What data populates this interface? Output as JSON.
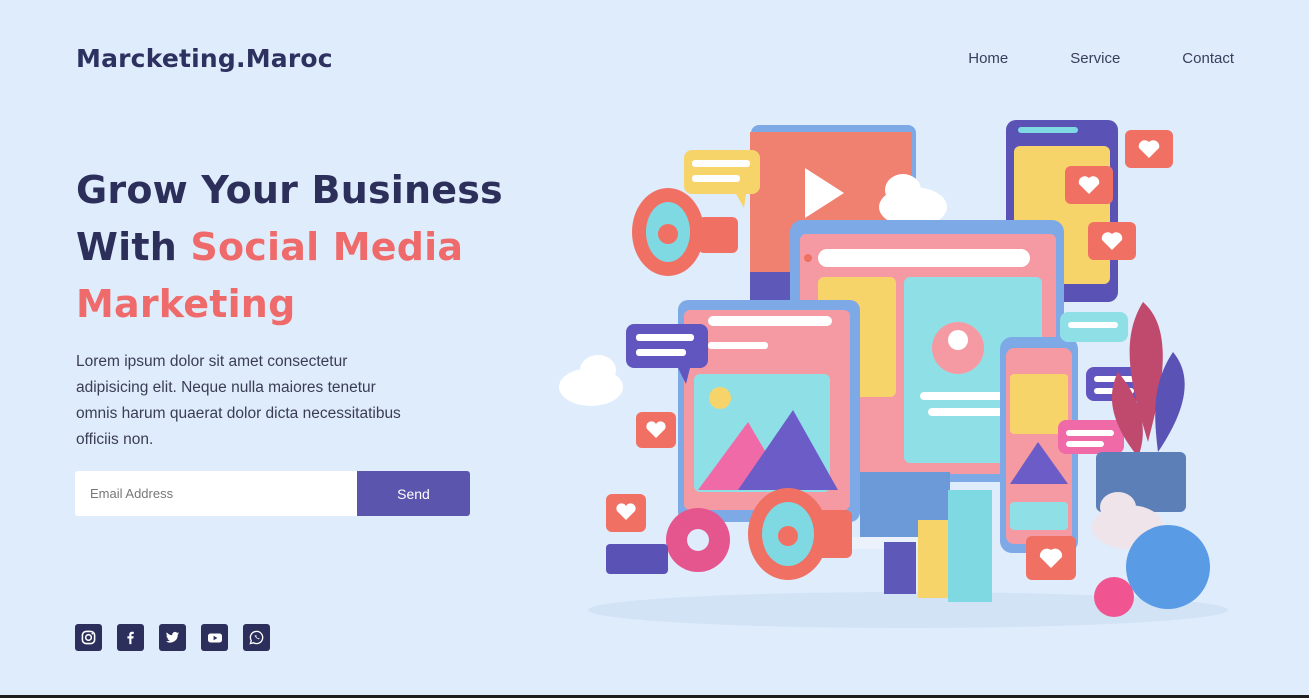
{
  "brand": {
    "name": "Marcketing.Maroc"
  },
  "nav": {
    "items": [
      {
        "label": "Home"
      },
      {
        "label": "Service"
      },
      {
        "label": "Contact"
      }
    ]
  },
  "hero": {
    "title_line1": "Grow Your Business",
    "title_with": "With",
    "title_accent1": "Social Media",
    "title_accent2": "Marketing",
    "description": "Lorem ipsum dolor sit amet consectetur adipisicing elit. Neque nulla maiores tenetur omnis harum quaerat dolor dicta necessitatibus officiis non."
  },
  "newsletter": {
    "placeholder": "Email Address",
    "button_label": "Send"
  },
  "social": {
    "icons": [
      "instagram-icon",
      "facebook-icon",
      "twitter-icon",
      "youtube-icon",
      "whatsapp-icon"
    ]
  },
  "colors": {
    "background": "#dfecfb",
    "heading": "#2b2f5a",
    "accent": "#ef6a6a",
    "button": "#5c55ad",
    "social_bg": "#2c2f5b"
  }
}
